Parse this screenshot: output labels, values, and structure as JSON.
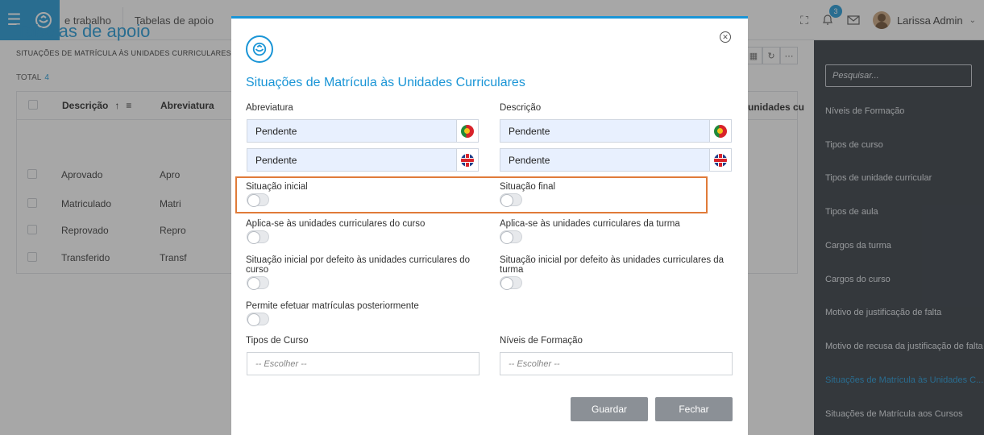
{
  "topbar": {
    "nav": [
      "e trabalho",
      "Tabelas de apoio"
    ],
    "notification_count": "3",
    "user_name": "Larissa Admin"
  },
  "page": {
    "title": "Tabelas de apoio",
    "subtitle": "SITUAÇÕES DE MATRÍCULA ÀS UNIDADES CURRICULARES",
    "total_label": "TOTAL",
    "total_value": "4",
    "columns": [
      "Descrição",
      "Abreviatura",
      "unidades cu"
    ],
    "rows": [
      {
        "descricao": "Aprovado",
        "abreviatura": "Apro"
      },
      {
        "descricao": "Matriculado",
        "abreviatura": "Matri"
      },
      {
        "descricao": "Reprovado",
        "abreviatura": "Repro"
      },
      {
        "descricao": "Transferido",
        "abreviatura": "Transf"
      }
    ]
  },
  "sidebar": {
    "search_placeholder": "Pesquisar...",
    "items": [
      "Níveis de Formação",
      "Tipos de curso",
      "Tipos de unidade curricular",
      "Tipos de aula",
      "Cargos da turma",
      "Cargos do curso",
      "Motivo de justificação de falta",
      "Motivo de recusa da justificação de falta",
      "Situações de Matrícula às Unidades C...",
      "Situações de Matrícula aos Cursos"
    ],
    "active_index": 8
  },
  "modal": {
    "title": "Situações de Matrícula às Unidades Curriculares",
    "abreviatura_label": "Abreviatura",
    "descricao_label": "Descrição",
    "abreviatura_pt": "Pendente",
    "abreviatura_en": "Pendente",
    "descricao_pt": "Pendente",
    "descricao_en": "Pendente",
    "toggles": {
      "situacao_inicial": "Situação inicial",
      "situacao_final": "Situação final",
      "aplica_curso": "Aplica-se às unidades curriculares do curso",
      "aplica_turma": "Aplica-se às unidades curriculares da turma",
      "inicial_defeito_curso": "Situação inicial por defeito às unidades curriculares do curso",
      "inicial_defeito_turma": "Situação inicial por defeito às unidades curriculares da turma",
      "permite_posterior": "Permite efetuar matrículas posteriormente"
    },
    "tipos_curso_label": "Tipos de Curso",
    "niveis_formacao_label": "Níveis de Formação",
    "select_placeholder": "-- Escolher --",
    "save_label": "Guardar",
    "close_label": "Fechar"
  },
  "colors": {
    "accent": "#1a95d6",
    "highlight": "#e07b39",
    "sidebar_bg": "#2e353d"
  }
}
